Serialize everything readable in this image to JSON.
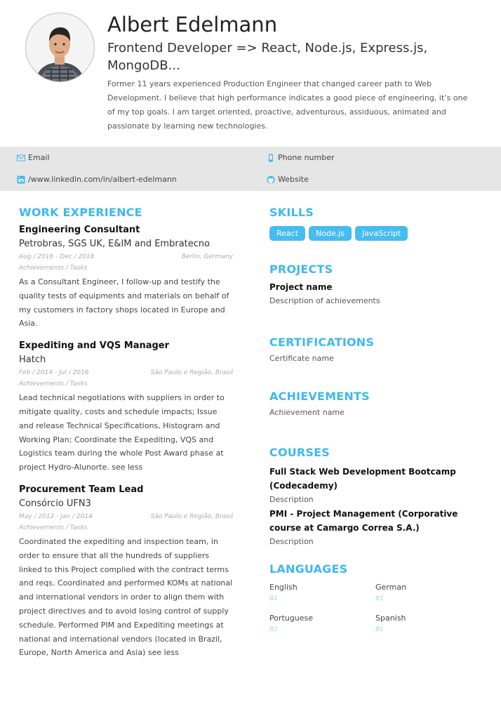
{
  "profile": {
    "name": "Albert Edelmann",
    "headline_line1": "Frontend Developer => React, Node.js, Express.js,",
    "headline_line2": "MongoDB...",
    "summary": "Former 11 years experienced Production Engineer that changed career path to Web Development. I believe that high performance indicates a good piece of engineering, it’s one of my top goals. I am target oriented, proactive, adventurous, assiduous, animated and passionate by learning new technologies."
  },
  "contact": {
    "email": "Email",
    "phone": "Phone number",
    "linkedin": "/www.linkedin.com/in/albert-edelmann",
    "website": "Website"
  },
  "work": {
    "title": "WORK EXPERIENCE",
    "jobs": [
      {
        "title": "Engineering Consultant",
        "company": "Petrobras, SGS UK, E&IM and Embratecno",
        "dates": "Aug / 2016 - Dec / 2018",
        "location": "Berlin, Germany",
        "sub": "Achievements / Tasks",
        "description": "As a Consultant Engineer, I follow-up and testify the quality tests of equipments and materials on behalf of my customers in factory shops located in Europe and Asia."
      },
      {
        "title": "Expediting and VQS Manager",
        "company": "Hatch",
        "dates": "Feb / 2014 - Jul / 2016",
        "location": "São Paulo e Região, Brasil",
        "sub": "Achievements / Tasks",
        "description": "Lead technical negotiations with suppliers in order to mitigate quality, costs and schedule impacts; Issue and release Technical Specifications, Histogram and Working Plan; Coordinate the Expediting, VQS and Logistics team during the whole Post Award phase at project Hydro-Alunorte. see less"
      },
      {
        "title": "Procurement Team Lead",
        "company": "Consórcio UFN3",
        "dates": "May / 2012 - Jan / 2014",
        "location": "São Paulo e Região, Brasil",
        "sub": "Achievements / Tasks",
        "description": "Coordinated the expediting and inspection team, in order to ensure that all the hundreds of suppliers linked to this Project complied with the contract terms and reqs. Coordinated and performed KOMs at national and international vendors in order to align them with project directives and to avoid losing control of supply schedule. Performed PIM and Expediting meetings at national and international vendors (located in Brazil, Europe, North America and Asia) see less"
      }
    ]
  },
  "skills": {
    "title": "SKILLS",
    "tags": [
      "React",
      "Node.js",
      "JavaScript"
    ]
  },
  "projects": {
    "title": "PROJECTS",
    "name": "Project name",
    "description": "Description of achievements"
  },
  "certifications": {
    "title": "CERTIFICATIONS",
    "name": "Certificate name"
  },
  "achievements": {
    "title": "ACHIEVEMENTS",
    "name": "Achievement name"
  },
  "courses": {
    "title": "COURSES",
    "items": [
      {
        "title": "Full Stack Web Development Bootcamp (Codecademy)",
        "description": "Description"
      },
      {
        "title": "PMI - Project Management (Corporative course at Camargo Correa S.A.)",
        "description": "Description"
      }
    ]
  },
  "languages": {
    "title": "LANGUAGES",
    "items": [
      {
        "name": "English",
        "level": "B1"
      },
      {
        "name": "German",
        "level": "B1"
      },
      {
        "name": "Portuguese",
        "level": "B1"
      },
      {
        "name": "Spanish",
        "level": "B1"
      }
    ]
  },
  "colors": {
    "accent": "#3fb8ee",
    "tag_bg": "#46bcf0",
    "band": "#e6e6e6"
  },
  "icons": {
    "email": "envelope-icon",
    "phone": "mobile-phone-icon",
    "linkedin": "linkedin-icon",
    "website": "github-icon"
  }
}
